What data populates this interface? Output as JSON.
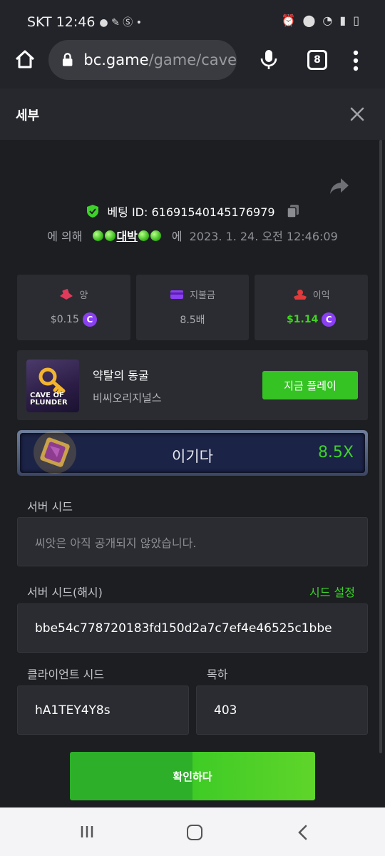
{
  "status_bar": {
    "carrier": "SKT",
    "time": "12:46"
  },
  "browser": {
    "url_host": "bc.game",
    "url_path": "/game/cave",
    "tab_count": "8"
  },
  "header": {
    "title": "세부"
  },
  "bet": {
    "id_label": "베팅 ID: 61691540145176979",
    "by_label": "에 의해",
    "username": "대박",
    "at_label": "에",
    "date": "2023. 1. 24. 오전 12:46:09"
  },
  "stats": [
    {
      "label": "양",
      "value": "$0.15",
      "icon": "money-icon",
      "color": "#e23a5b"
    },
    {
      "label": "지불금",
      "value": "8.5배",
      "icon": "card-icon",
      "color": "#8a3ff2"
    },
    {
      "label": "이익",
      "value": "$1.14",
      "icon": "profit-icon",
      "color": "#e23a3a"
    }
  ],
  "game": {
    "name": "약탈의 동굴",
    "provider": "비씨오리지널스",
    "thumb_caption_1": "CAVE OF",
    "thumb_caption_2": "PLUNDER",
    "play_label": "지금 플레이"
  },
  "result": {
    "text": "이기다",
    "multiplier": "8.5X"
  },
  "server_seed": {
    "label": "서버 시드",
    "value": "씨앗은 아직 공개되지 않았습니다."
  },
  "server_seed_hash": {
    "label": "서버 시드(해시)",
    "link": "시드 설정",
    "value": "bbe54c778720183fd150d2a7c7ef4e46525c1bbe"
  },
  "client_seed": {
    "label": "클라이언트 시드",
    "value": "hA1TEY4Y8s"
  },
  "nonce": {
    "label": "목하",
    "value": "403"
  },
  "confirm_label": "확인하다",
  "colors": {
    "accent_green": "#35c324",
    "coin_purple": "#8a3ff2"
  }
}
